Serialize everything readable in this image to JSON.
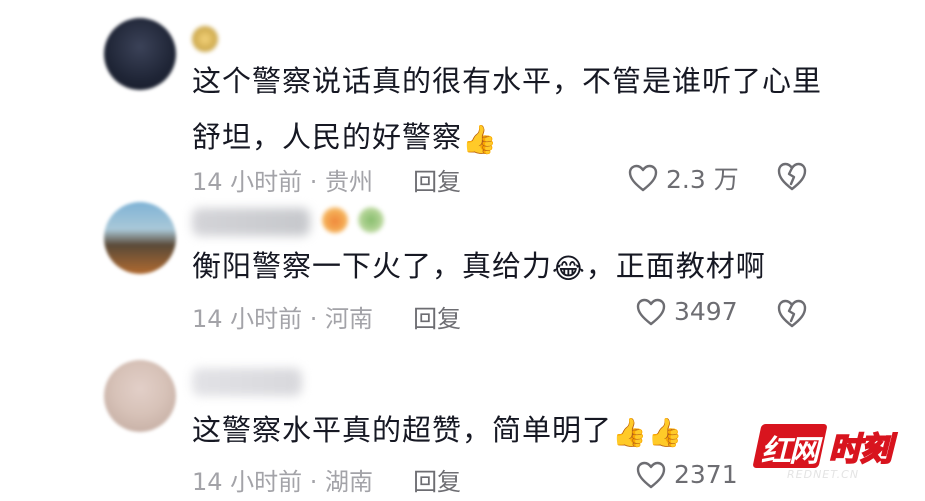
{
  "comments": [
    {
      "text_line1": "这个警察说话真的很有水平，不管是谁听了心里",
      "text_line2": "舒坦，人民的好警察",
      "emoji": "👍",
      "time": "14 小时前 · 贵州",
      "reply": "回复",
      "likes": "2.3 万"
    },
    {
      "text_before": "衡阳警察一下火了，真给力",
      "emoji": "😂",
      "text_after": "，正面教材啊",
      "time": "14 小时前 · 河南",
      "reply": "回复",
      "likes": "3497"
    },
    {
      "text": "这警察水平真的超赞，简单明了",
      "emoji": "👍👍",
      "time": "14 小时前 · 湖南",
      "reply": "回复",
      "likes": "2371"
    }
  ],
  "icons": {
    "like": "heart-outline-icon",
    "dislike": "broken-heart-icon"
  },
  "watermark": {
    "badge": "红网",
    "text": "时刻",
    "sub": "REDNET.CN"
  },
  "colors": {
    "text": "#161823",
    "meta": "#a3a3a8",
    "action": "#6d6d72",
    "watermark_red": "#d8141e"
  }
}
